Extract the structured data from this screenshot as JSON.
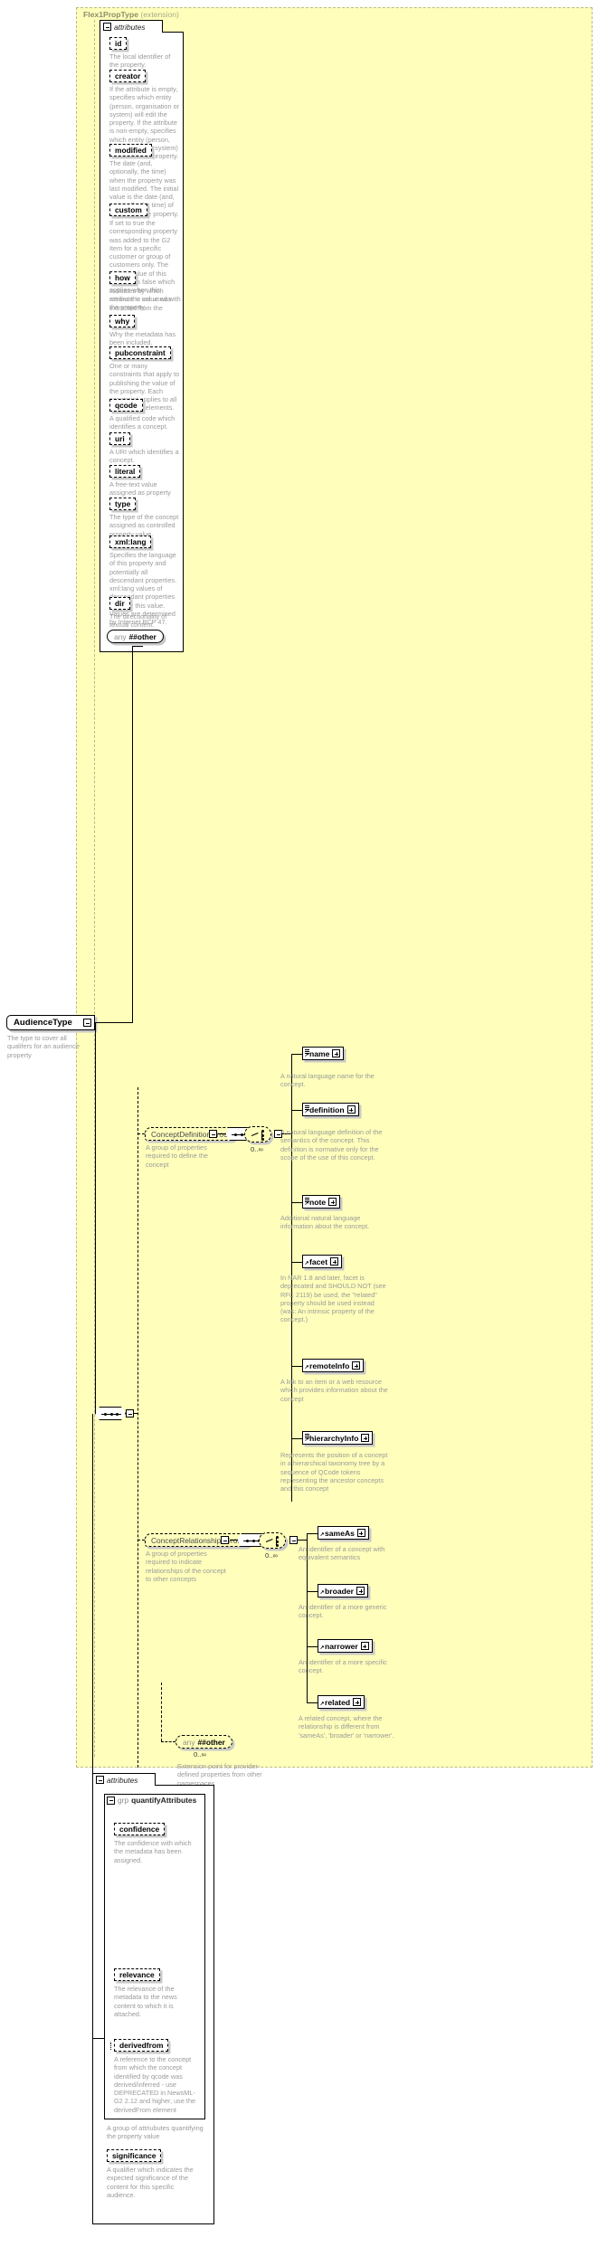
{
  "diagram": {
    "title": "Flex1PropType",
    "title_suffix": "(extension)",
    "type_name": "AudienceType",
    "type_doc": "The type to cover all qualifers for an audience property",
    "attributes_label": "attributes",
    "group_keyword": "grp",
    "quantify_group_name": "quantifyAttributes",
    "quantify_group_doc": "A group of attriubutes quantifying the property value",
    "any_label": "any",
    "any_namespace": "##other",
    "cardinality_unbounded": "0..∞",
    "any_extension_doc": "Extension point for provider-defined properties from other namespaces"
  },
  "attributes": [
    {
      "name": "id",
      "doc": "The local identifier of the property."
    },
    {
      "name": "creator",
      "doc": "If the attribute is empty, specifies which entity (person, organisation or system) will edit the property. If the attribute is non-empty, specifies which entity (person, organisation or system) has edited the property."
    },
    {
      "name": "modified",
      "doc": "The date (and, optionally, the time) when the property was last modified. The initial value is the date (and, optionally, the time) of creation of the property."
    },
    {
      "name": "custom",
      "doc": "If set to true the corresponding property was added to the G2 Item for a specific customer or group of customers only. The default value of this property is false which applies when this attribute is not used with the property."
    },
    {
      "name": "how",
      "doc": "Indicates by which means the value was extracted from the content."
    },
    {
      "name": "why",
      "doc": "Why the metadata has been included."
    },
    {
      "name": "pubconstraint",
      "doc": "One or many constraints that apply to publishing the value of the property. Each constraint applies to all descendant elements."
    },
    {
      "name": "qcode",
      "doc": "A qualified code which identifies a concept."
    },
    {
      "name": "uri",
      "doc": "A URI which identifies a concept."
    },
    {
      "name": "literal",
      "doc": "A free-text value assigned as property value."
    },
    {
      "name": "type",
      "doc": "The type of the concept assigned as controlled property value."
    },
    {
      "name": "xml:lang",
      "doc": "Specifies the language of this property and potentially all descendant properties. xml:lang values of descendant properties override this value. Values are determined by Internet BCP 47."
    },
    {
      "name": "dir",
      "doc": "The directionality of textual content."
    }
  ],
  "groups": [
    {
      "name": "ConceptDefinitionGroup",
      "doc": "A group of properties required to define the concept",
      "cardinality": "0..∞",
      "elements": [
        {
          "name": "name",
          "doc": "A natural language name for the concept."
        },
        {
          "name": "definition",
          "doc": "A natural language definition of the semantics of the concept. This definition is normative only for the scope of the use of this concept."
        },
        {
          "name": "note",
          "doc": "Additional natural language information about the concept."
        },
        {
          "name": "facet",
          "doc": "In NAR 1.8 and later, facet is deprecated and SHOULD NOT (see RFC 2119) be used, the \"related\" property should be used instead (was: An intrinsic property of the concept.)"
        },
        {
          "name": "remoteInfo",
          "doc": "A link to an item or a web resource which provides information about the concept"
        },
        {
          "name": "hierarchyInfo",
          "doc": "Represents the position of a concept in a hierarchical taxonomy tree by a sequence of QCode tokens representing the ancestor concepts and this concept"
        }
      ]
    },
    {
      "name": "ConceptRelationshipsGroup",
      "doc": "A group of properties required to indicate relationships of the concept to other concepts",
      "cardinality": "0..∞",
      "elements": [
        {
          "name": "sameAs",
          "doc": "An identifier of a concept with equivalent semantics"
        },
        {
          "name": "broader",
          "doc": "An identifier of a more generic concept."
        },
        {
          "name": "narrower",
          "doc": "An identifier of a more specific concept."
        },
        {
          "name": "related",
          "doc": "A related concept, where the relationship is different from 'sameAs', 'broader' or 'narrower'."
        }
      ]
    }
  ],
  "quantify_attributes": [
    {
      "name": "confidence",
      "doc": "The confidence with which the metadata has been assigned."
    },
    {
      "name": "relevance",
      "doc": "The relevance of the metadata to the news content to which it is attached."
    },
    {
      "name": "derivedfrom",
      "doc": "A reference to the concept from which the concept identified by qcode was derived/inferred - use DEPRECATED in NewsML-G2 2.12 and higher, use the derivedFrom element",
      "optional_marker": true
    }
  ],
  "bottom_attributes": [
    {
      "name": "significance",
      "doc": "A qualifier which indicates the expected significance of the content for this specific audience."
    }
  ],
  "colors": {
    "extension_fill": "#ffffbb",
    "extension_border": "#b9b98a",
    "doc_text": "#9a9a9a",
    "shadow": "#c8c8c8",
    "title_text": "#8c8c6a"
  }
}
